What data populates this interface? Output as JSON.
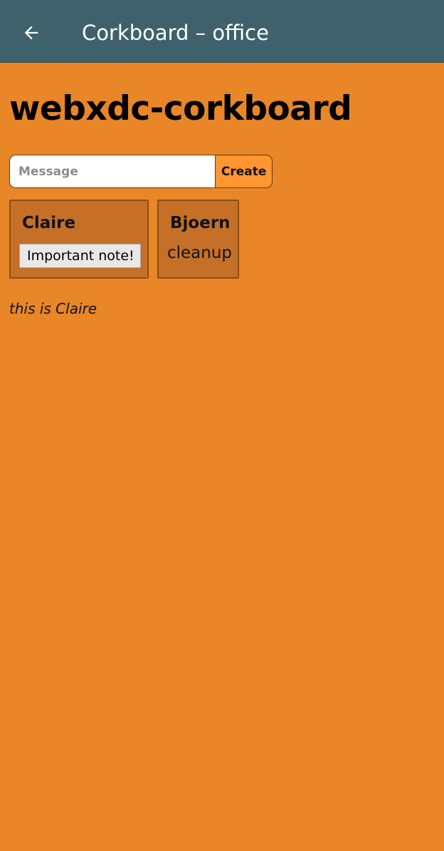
{
  "appbar": {
    "back_icon": "arrow-left-icon",
    "title": "Corkboard – office",
    "background": "#3e616b"
  },
  "page": {
    "title": "webxdc-corkboard",
    "background": "#e88628"
  },
  "form": {
    "message_placeholder": "Message",
    "message_value": "",
    "create_label": "Create"
  },
  "cards": [
    {
      "author": "Claire",
      "note": "Important note!",
      "editing": true
    },
    {
      "author": "Bjoern",
      "note": "cleanup",
      "editing": false
    }
  ],
  "status": {
    "text": "this is Claire"
  }
}
